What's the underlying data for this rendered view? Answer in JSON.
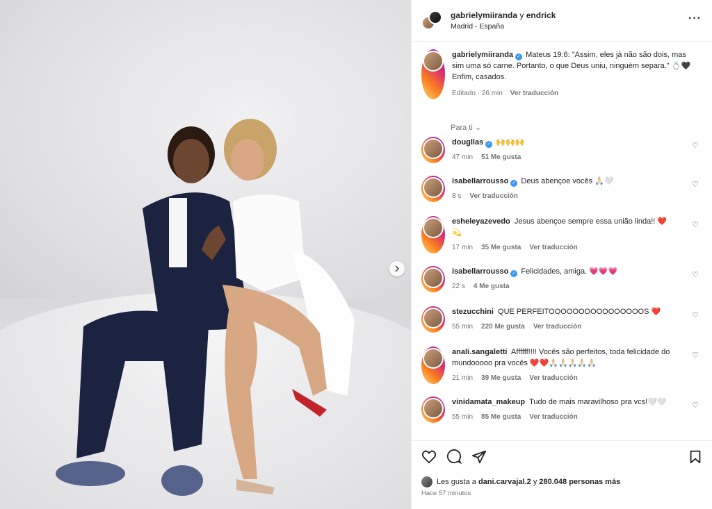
{
  "header": {
    "user1": "gabrielymiiranda",
    "conjunction": "y",
    "user2": "endrick",
    "location": "Madrid - España"
  },
  "caption": {
    "username": "gabrielymiiranda",
    "text_line1": "Mateus 19:6: \"Assim, eles já não são dois, mas sim uma só carne. Portanto, o que Deus uniu, ninguém separa.\" 💍🖤",
    "text_line2": "Enfim, casados.",
    "edited": "Editado · 26 min",
    "translate": "Ver traducción"
  },
  "para_ti": "Para ti",
  "comments": [
    {
      "username": "dougllas",
      "verified": true,
      "text": "🙌🙌🙌",
      "time": "47 min",
      "likes": "51 Me gusta",
      "translate": ""
    },
    {
      "username": "isabellarrousso",
      "verified": true,
      "text": "Deus abençoe vocês 🙏🏻🤍",
      "time": "8 s",
      "likes": "",
      "translate": "Ver traducción"
    },
    {
      "username": "esheleyazevedo",
      "verified": false,
      "text": "Jesus abençoe sempre essa união linda!! ❤️💫",
      "time": "17 min",
      "likes": "35 Me gusta",
      "translate": "Ver traducción"
    },
    {
      "username": "isabellarrousso",
      "verified": true,
      "text": "Felicidades, amiga. 💗💗💗",
      "time": "22 s",
      "likes": "4 Me gusta",
      "translate": ""
    },
    {
      "username": "stezucchini",
      "verified": false,
      "text": "QUE PERFEITOOOOOOOOOOOOOOOOS ❤️",
      "time": "55 min",
      "likes": "220 Me gusta",
      "translate": "Ver traducción"
    },
    {
      "username": "anali.sangaletti",
      "verified": false,
      "text": "Affffff!!!! Vocês são perfeitos, toda felicidade do mundooooo pra vocês ❤️❤️🙏🏻🙏🏻🙏🏻🙏🏻🙏🏻",
      "time": "21 min",
      "likes": "39 Me gusta",
      "translate": "Ver traducción"
    },
    {
      "username": "vinidamata_makeup",
      "verified": false,
      "text": "Tudo de mais maravilhoso pra vcs!🤍🤍",
      "time": "55 min",
      "likes": "85 Me gusta",
      "translate": "Ver traducción"
    }
  ],
  "likes_line": {
    "prefix": "Les gusta a",
    "user": "dani.carvajal.2",
    "middle": "y",
    "count": "280.048 personas más"
  },
  "time_ago": "Hace 57 minutos",
  "colors": {
    "verified": "#3897f0",
    "muted": "#737373",
    "text": "#262626"
  }
}
